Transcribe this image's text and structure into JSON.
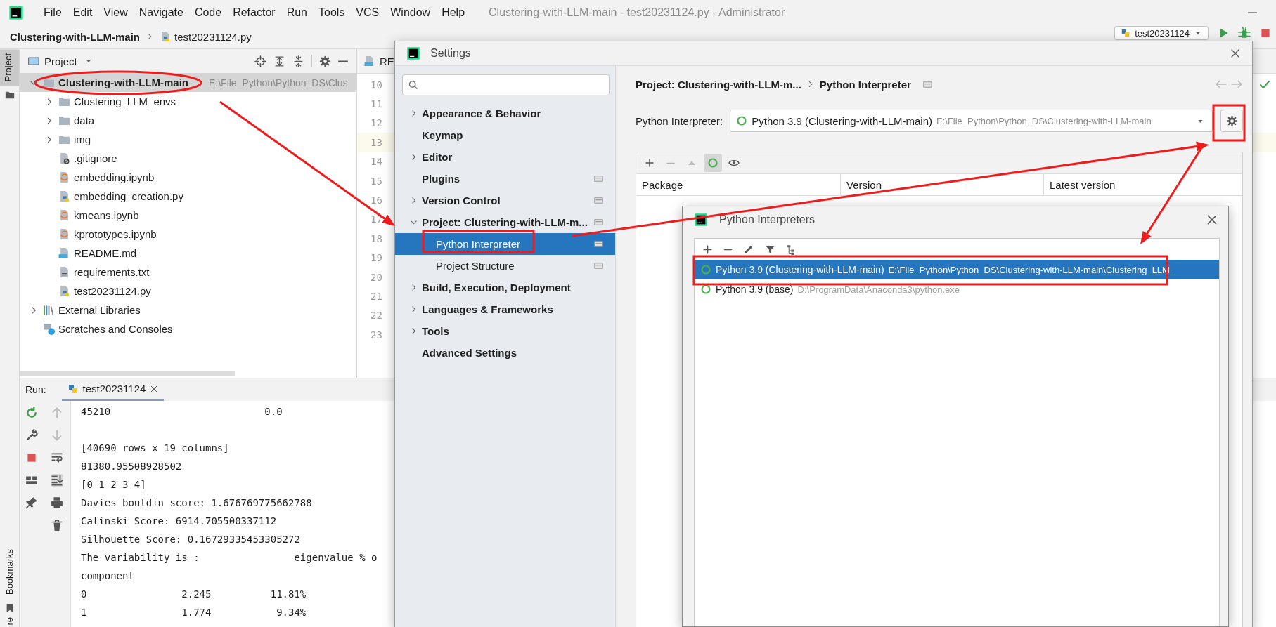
{
  "menu_bar": {
    "items": [
      "File",
      "Edit",
      "View",
      "Navigate",
      "Code",
      "Refactor",
      "Run",
      "Tools",
      "VCS",
      "Window",
      "Help"
    ],
    "window_title": "Clustering-with-LLM-main - test20231124.py - Administrator"
  },
  "navigation_bar": {
    "breadcrumb": [
      "Clustering-with-LLM-main",
      "test20231124.py"
    ],
    "run_configuration": "test20231124"
  },
  "tool_window_strip": {
    "top_tab": "Project",
    "bottom_tab": "Bookmarks",
    "cut_tab": "re"
  },
  "project_panel": {
    "title": "Project",
    "tree": [
      {
        "label": "Clustering-with-LLM-main",
        "path": "E:\\File_Python\\Python_DS\\Clus",
        "kind": "folder",
        "expanded": true,
        "selected": true,
        "children": [
          {
            "label": "Clustering_LLM_envs",
            "kind": "folder",
            "expanded": false,
            "selected": false
          },
          {
            "label": "data",
            "kind": "folder",
            "expanded": false,
            "selected": false
          },
          {
            "label": "img",
            "kind": "folder",
            "expanded": false,
            "selected": false
          },
          {
            "label": ".gitignore",
            "kind": "ignore",
            "selected": false
          },
          {
            "label": "embedding.ipynb",
            "kind": "notebook",
            "selected": false
          },
          {
            "label": "embedding_creation.py",
            "kind": "python",
            "selected": false
          },
          {
            "label": "kmeans.ipynb",
            "kind": "notebook",
            "selected": false
          },
          {
            "label": "kprototypes.ipynb",
            "kind": "notebook",
            "selected": false
          },
          {
            "label": "README.md",
            "kind": "markdown",
            "selected": false
          },
          {
            "label": "requirements.txt",
            "kind": "text",
            "selected": false
          },
          {
            "label": "test20231124.py",
            "kind": "python",
            "selected": false
          }
        ]
      },
      {
        "label": "External Libraries",
        "kind": "library",
        "expanded": false,
        "selected": false
      },
      {
        "label": "Scratches and Consoles",
        "kind": "scratches",
        "selected": false
      }
    ]
  },
  "editor": {
    "tab": "RE",
    "lines": [
      {
        "number": "10",
        "current": false
      },
      {
        "number": "11",
        "current": false
      },
      {
        "number": "12",
        "current": false
      },
      {
        "number": "13",
        "current": true
      },
      {
        "number": "14",
        "current": false
      },
      {
        "number": "15",
        "current": false
      },
      {
        "number": "16",
        "current": false
      },
      {
        "number": "17",
        "current": false
      },
      {
        "number": "18",
        "current": false
      },
      {
        "number": "19",
        "current": false
      },
      {
        "number": "20",
        "current": false
      },
      {
        "number": "21",
        "current": false
      },
      {
        "number": "22",
        "current": false
      },
      {
        "number": "23",
        "current": false
      }
    ]
  },
  "run_panel": {
    "label": "Run:",
    "tab": "test20231124",
    "console_blocks": [
      {
        "lines": [
          "45210                          0.0"
        ]
      },
      {
        "lines": [
          "[40690 rows x 19 columns]",
          "81380.95508928502",
          "[0 1 2 3 4]",
          "Davies bouldin score: 1.676769775662788",
          "Calinski Score: 6914.705500337112",
          "Silhouette Score: 0.16729335453305272",
          "The variability is :                eigenvalue % o",
          "component",
          "0                2.245          11.81%",
          "1                1.774           9.34%"
        ]
      }
    ]
  },
  "settings_dialog": {
    "title": "Settings",
    "tree": [
      {
        "label": "Appearance & Behavior",
        "expanded": false,
        "selected": false,
        "scope_icon": false
      },
      {
        "label": "Keymap",
        "selected": false,
        "scope_icon": false
      },
      {
        "label": "Editor",
        "expanded": false,
        "selected": false,
        "scope_icon": false
      },
      {
        "label": "Plugins",
        "selected": false,
        "scope_icon": true
      },
      {
        "label": "Version Control",
        "expanded": false,
        "selected": false,
        "scope_icon": true
      },
      {
        "label": "Project: Clustering-with-LLM-m...",
        "expanded": true,
        "selected": false,
        "scope_icon": true,
        "children": [
          {
            "label": "Python Interpreter",
            "selected": true,
            "scope_icon": true
          },
          {
            "label": "Project Structure",
            "selected": false,
            "scope_icon": true
          }
        ]
      },
      {
        "label": "Build, Execution, Deployment",
        "expanded": false,
        "selected": false,
        "scope_icon": false
      },
      {
        "label": "Languages & Frameworks",
        "expanded": false,
        "selected": false,
        "scope_icon": false
      },
      {
        "label": "Tools",
        "expanded": false,
        "selected": false,
        "scope_icon": false
      },
      {
        "label": "Advanced Settings",
        "selected": false,
        "scope_icon": false
      }
    ],
    "breadcrumb": [
      "Project: Clustering-with-LLM-m...",
      "Python Interpreter"
    ],
    "interpreter_label": "Python Interpreter:",
    "interpreter": {
      "name": "Python 3.9 (Clustering-with-LLM-main)",
      "path": "E:\\File_Python\\Python_DS\\Clustering-with-LLM-main"
    },
    "package_toolbar": [
      {
        "kind": "add",
        "disabled": false,
        "on": false
      },
      {
        "kind": "remove",
        "disabled": true,
        "on": false
      },
      {
        "kind": "up",
        "disabled": true,
        "on": false
      },
      {
        "kind": "spinner",
        "disabled": false,
        "on": true
      },
      {
        "kind": "eye",
        "disabled": false,
        "on": false
      }
    ],
    "columns": [
      "Package",
      "Version",
      "Latest version"
    ]
  },
  "interpreters_dialog": {
    "title": "Python Interpreters",
    "toolbar": [
      {
        "kind": "add"
      },
      {
        "kind": "remove"
      },
      {
        "kind": "edit"
      },
      {
        "kind": "filter"
      },
      {
        "kind": "tree"
      }
    ],
    "items": [
      {
        "name": "Python 3.9 (Clustering-with-LLM-main)",
        "path": "E:\\File_Python\\Python_DS\\Clustering-with-LLM-main\\Clustering_LLM_",
        "selected": true
      },
      {
        "name": "Python 3.9 (base)",
        "path": "D:\\ProgramData\\Anaconda3\\python.exe",
        "selected": false
      }
    ]
  }
}
